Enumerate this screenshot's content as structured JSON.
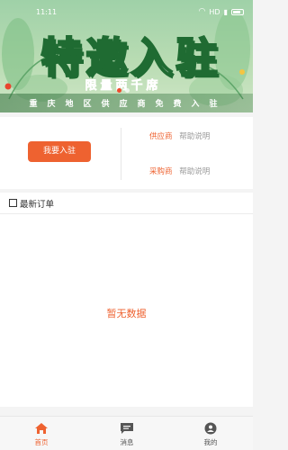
{
  "status_bar": {
    "time": "11:11",
    "network": "HD"
  },
  "banner": {
    "title": "特邀入驻",
    "subtitle": "限量两千席",
    "tagline": "重庆地区供应商免费入驻"
  },
  "join": {
    "button_label": "我要入驻",
    "supplier_label": "供应商",
    "supplier_help": "帮助说明",
    "purchaser_label": "采购商",
    "purchaser_help": "帮助说明"
  },
  "orders": {
    "title": "最新订单",
    "empty_text": "暂无数据"
  },
  "tabbar": {
    "home": "首页",
    "messages": "消息",
    "mine": "我的"
  },
  "colors": {
    "accent": "#ee6230",
    "banner_green": "#1f6b32"
  }
}
